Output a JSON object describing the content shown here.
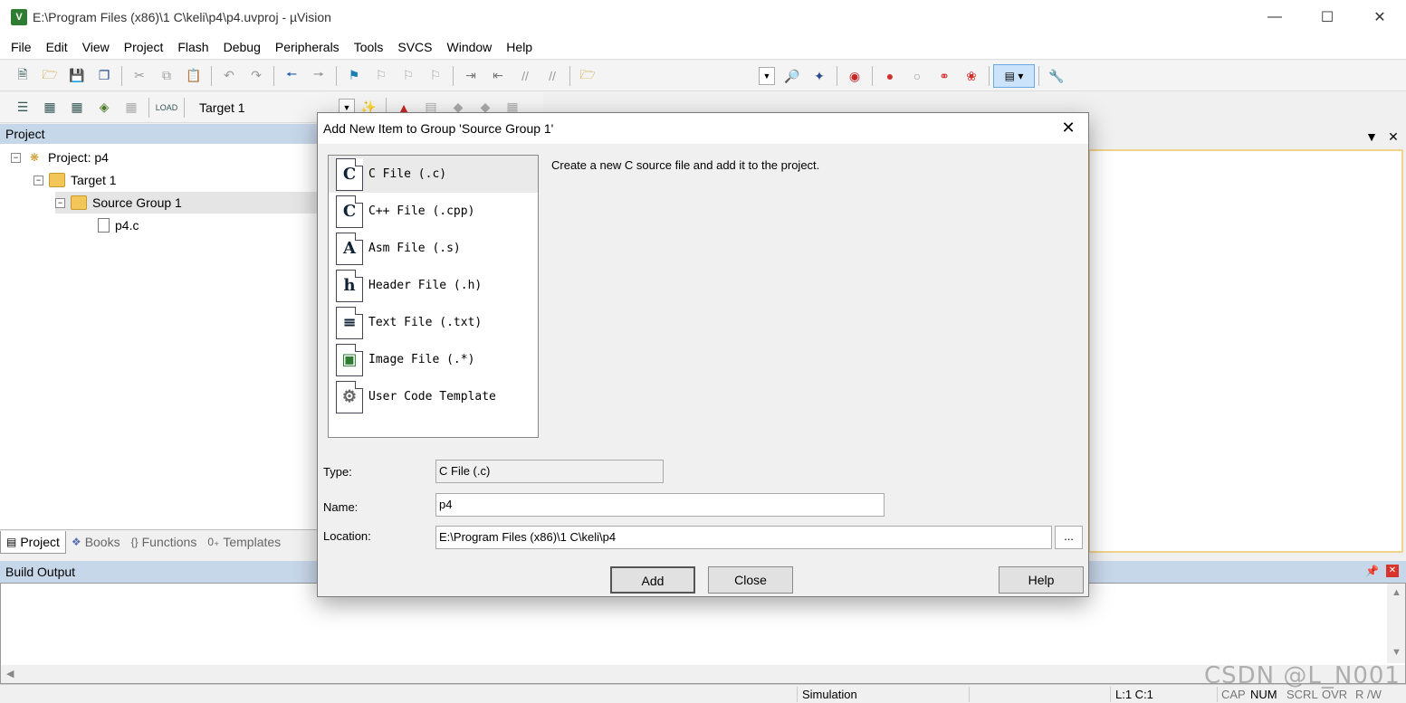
{
  "window": {
    "title": "E:\\Program Files (x86)\\1 C\\keli\\p4\\p4.uvproj - µVision",
    "app_icon": "V"
  },
  "menu": [
    "File",
    "Edit",
    "View",
    "Project",
    "Flash",
    "Debug",
    "Peripherals",
    "Tools",
    "SVCS",
    "Window",
    "Help"
  ],
  "toolbar2": {
    "target": "Target 1"
  },
  "project_panel": {
    "header": "Project",
    "tree": {
      "project": "Project: p4",
      "target": "Target 1",
      "group": "Source Group 1",
      "file": "p4.c"
    },
    "tabs": [
      "Project",
      "Books",
      "Functions",
      "Templates"
    ]
  },
  "build_output": {
    "header": "Build Output"
  },
  "status": {
    "mode": "Simulation",
    "position": "L:1 C:1",
    "flags": [
      "CAP",
      "NUM",
      "SCRL",
      "OVR",
      "R /W"
    ]
  },
  "watermark": "CSDN @L_N001",
  "dialog": {
    "title": "Add New Item to Group 'Source Group 1'",
    "items": [
      {
        "icon": "C",
        "label": "C File (.c)"
      },
      {
        "icon": "C",
        "label": "C++ File (.cpp)"
      },
      {
        "icon": "A",
        "label": "Asm File (.s)"
      },
      {
        "icon": "h",
        "label": "Header File (.h)"
      },
      {
        "icon": "≡",
        "label": "Text File (.txt)"
      },
      {
        "icon": "▣",
        "label": "Image File (.*)"
      },
      {
        "icon": "⚙",
        "label": "User Code Template"
      }
    ],
    "description": "Create a new C source file and add it to the project.",
    "type_label": "Type:",
    "type_value": "C File (.c)",
    "name_label": "Name:",
    "name_value": "p4",
    "location_label": "Location:",
    "location_value": "E:\\Program Files (x86)\\1 C\\keli\\p4",
    "browse_label": "...",
    "buttons": {
      "add": "Add",
      "close": "Close",
      "help": "Help"
    }
  }
}
